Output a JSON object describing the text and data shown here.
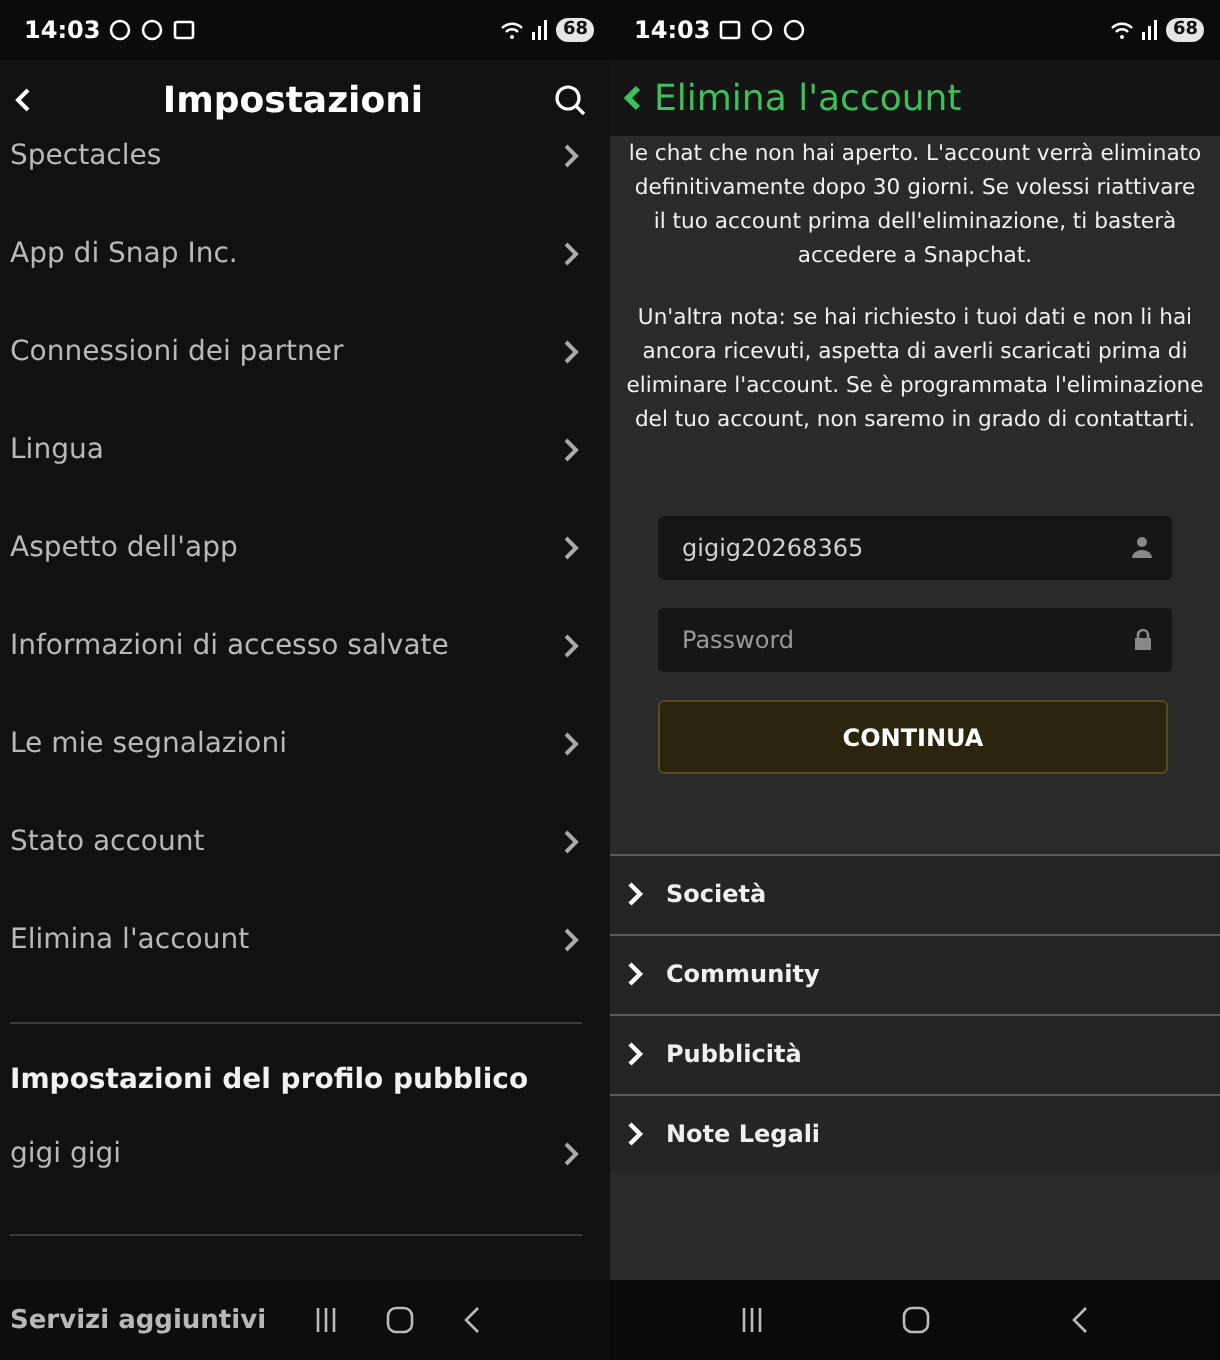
{
  "left": {
    "status_bar": {
      "time": "14:03",
      "battery": "68"
    },
    "header": {
      "title": "Impostazioni"
    },
    "items": [
      {
        "label": "Spectacles"
      },
      {
        "label": "App di Snap Inc."
      },
      {
        "label": "Connessioni dei partner"
      },
      {
        "label": "Lingua"
      },
      {
        "label": "Aspetto dell'app"
      },
      {
        "label": "Informazioni di accesso salvate"
      },
      {
        "label": "Le mie segnalazioni"
      },
      {
        "label": "Stato account"
      },
      {
        "label": "Elimina l'account"
      }
    ],
    "section": {
      "title": "Impostazioni del profilo pubblico",
      "items": [
        {
          "label": "gigi gigi"
        }
      ]
    },
    "next_section": {
      "title": "Servizi aggiuntivi"
    }
  },
  "right": {
    "status_bar": {
      "time": "14:03",
      "battery": "68"
    },
    "header": {
      "title": "Elimina l'account"
    },
    "paragraphs": [
      "le chat che non hai aperto. L'account verrà eliminato definitivamente dopo 30 giorni. Se volessi riattivare il tuo account prima dell'eliminazione, ti basterà accedere a Snapchat.",
      "Un'altra nota: se hai richiesto i tuoi dati e non li hai ancora ricevuti, aspetta di averli scaricati prima di eliminare l'account. Se è programmata l'eliminazione del tuo account, non saremo in grado di contattarti."
    ],
    "username": {
      "value": "gigig20268365"
    },
    "password": {
      "placeholder": "Password"
    },
    "button": "CONTINUA",
    "footer_links": [
      {
        "label": "Società",
        "expanded": false
      },
      {
        "label": "Community",
        "expanded": false
      },
      {
        "label": "Pubblicità",
        "expanded": false
      },
      {
        "label": "Note Legali",
        "expanded": false
      }
    ]
  }
}
